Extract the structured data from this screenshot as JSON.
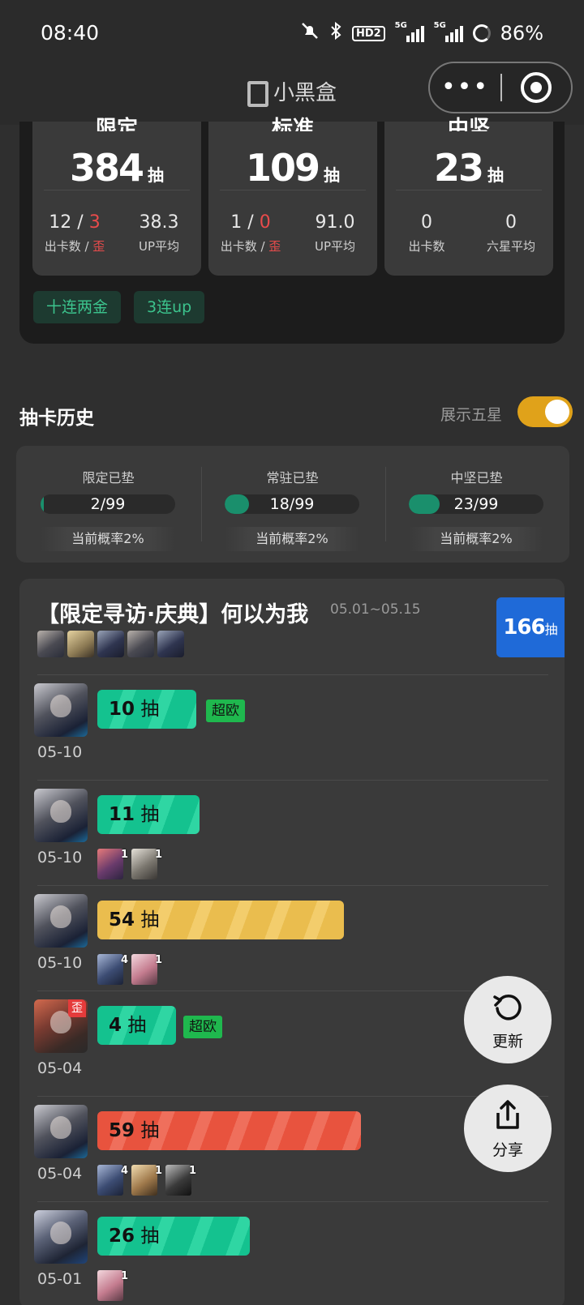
{
  "status": {
    "time": "08:40",
    "battery": "86%",
    "hd": "HD2",
    "net1": "5G",
    "net2": "5G"
  },
  "nav": {
    "title": "小黑盒",
    "more": "•••"
  },
  "summary": {
    "cards": [
      {
        "title": "限定",
        "count": "384",
        "unit": "抽",
        "v1a": "12 / ",
        "v1b": "3",
        "l1a": "出卡数 / ",
        "l1b": "歪",
        "v2": "38.3",
        "l2": "UP平均"
      },
      {
        "title": "标准",
        "count": "109",
        "unit": "抽",
        "v1a": "1 / ",
        "v1b": "0",
        "l1a": "出卡数 / ",
        "l1b": "歪",
        "v2": "91.0",
        "l2": "UP平均"
      },
      {
        "title": "中坚",
        "count": "23",
        "unit": "抽",
        "v1a": "0",
        "v1b": "",
        "l1a": "出卡数",
        "l1b": "",
        "v2": "0",
        "l2": "六星平均"
      }
    ],
    "tags": [
      "十连两金",
      "3连up"
    ]
  },
  "history": {
    "title": "抽卡历史",
    "toggle_label": "展示五星",
    "toggle_on": true,
    "pity": [
      {
        "label": "限定已垫",
        "value": "2/99",
        "fraction": 0.02,
        "rate": "当前概率2%"
      },
      {
        "label": "常驻已垫",
        "value": "18/99",
        "fraction": 0.18,
        "rate": "当前概率2%"
      },
      {
        "label": "中坚已垫",
        "value": "23/99",
        "fraction": 0.23,
        "rate": "当前概率2%"
      }
    ]
  },
  "banner": {
    "title": "【限定寻访·庆典】何以为我",
    "date": "05.01~05.15",
    "total": "166",
    "total_unit": "抽"
  },
  "pulls": [
    {
      "date": "05-10",
      "count": "10",
      "unit": "抽",
      "color": "green",
      "badge": "超欧",
      "extras": [],
      "wai": ""
    },
    {
      "date": "05-10",
      "count": "11",
      "unit": "抽",
      "color": "green",
      "badge": "",
      "extras": [
        "1",
        "1"
      ],
      "wai": ""
    },
    {
      "date": "05-10",
      "count": "54",
      "unit": "抽",
      "color": "yellow",
      "badge": "",
      "extras": [
        "4",
        "1"
      ],
      "wai": ""
    },
    {
      "date": "05-04",
      "count": "4",
      "unit": "抽",
      "color": "green",
      "badge": "超欧",
      "extras": [],
      "wai": "歪"
    },
    {
      "date": "05-04",
      "count": "59",
      "unit": "抽",
      "color": "red",
      "badge": "",
      "extras": [
        "4",
        "1",
        "1"
      ],
      "wai": ""
    },
    {
      "date": "05-01",
      "count": "26",
      "unit": "抽",
      "color": "green",
      "badge": "",
      "extras": [
        "1"
      ],
      "wai": ""
    }
  ],
  "fab": {
    "refresh": "更新",
    "share": "分享"
  },
  "colors": {
    "accent_green": "#14c28f",
    "accent_yellow": "#eabd4e",
    "accent_red": "#e8533e",
    "total_blue": "#1f6ad8",
    "toggle": "#e0a21a"
  }
}
